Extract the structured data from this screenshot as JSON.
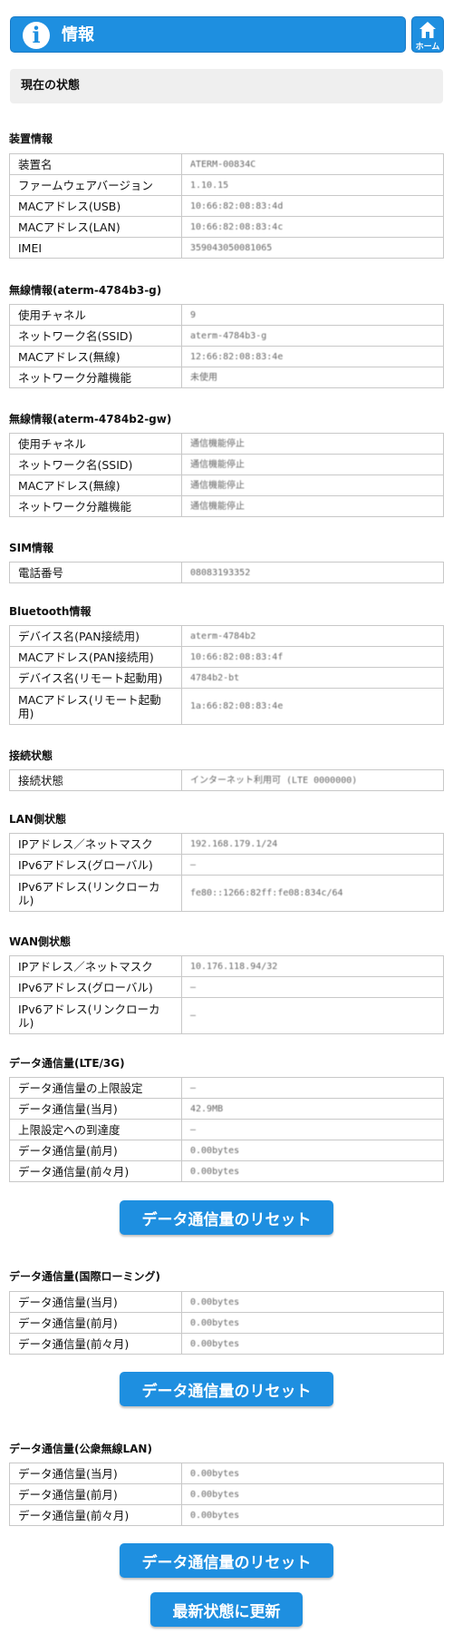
{
  "header": {
    "title": "情報",
    "home_label": "ホーム"
  },
  "status_heading": "現在の状態",
  "sections": {
    "device": {
      "title": "装置情報",
      "rows": [
        {
          "label": "装置名",
          "value": "ATERM-00834C"
        },
        {
          "label": "ファームウェアバージョン",
          "value": "1.10.15"
        },
        {
          "label": "MACアドレス(USB)",
          "value": "10:66:82:08:83:4d"
        },
        {
          "label": "MACアドレス(LAN)",
          "value": "10:66:82:08:83:4c"
        },
        {
          "label": "IMEI",
          "value": "359043050081065"
        }
      ]
    },
    "wireless1": {
      "title": "無線情報(aterm-4784b3-g)",
      "rows": [
        {
          "label": "使用チャネル",
          "value": "9"
        },
        {
          "label": "ネットワーク名(SSID)",
          "value": "aterm-4784b3-g"
        },
        {
          "label": "MACアドレス(無線)",
          "value": "12:66:82:08:83:4e"
        },
        {
          "label": "ネットワーク分離機能",
          "value": "未使用"
        }
      ]
    },
    "wireless2": {
      "title": "無線情報(aterm-4784b2-gw)",
      "rows": [
        {
          "label": "使用チャネル",
          "value": "通信機能停止"
        },
        {
          "label": "ネットワーク名(SSID)",
          "value": "通信機能停止"
        },
        {
          "label": "MACアドレス(無線)",
          "value": "通信機能停止"
        },
        {
          "label": "ネットワーク分離機能",
          "value": "通信機能停止"
        }
      ]
    },
    "sim": {
      "title": "SIM情報",
      "rows": [
        {
          "label": "電話番号",
          "value": "08083193352"
        }
      ]
    },
    "bluetooth": {
      "title": "Bluetooth情報",
      "rows": [
        {
          "label": "デバイス名(PAN接続用)",
          "value": "aterm-4784b2"
        },
        {
          "label": "MACアドレス(PAN接続用)",
          "value": "10:66:82:08:83:4f"
        },
        {
          "label": "デバイス名(リモート起動用)",
          "value": "4784b2-bt"
        },
        {
          "label": "MACアドレス(リモート起動用)",
          "value": "1a:66:82:08:83:4e"
        }
      ]
    },
    "connection": {
      "title": "接続状態",
      "rows": [
        {
          "label": "接続状態",
          "value": "インターネット利用可 (LTE 0000000)"
        }
      ]
    },
    "lan": {
      "title": "LAN側状態",
      "rows": [
        {
          "label": "IPアドレス／ネットマスク",
          "value": "192.168.179.1/24"
        },
        {
          "label": "IPv6アドレス(グローバル)",
          "value": "—"
        },
        {
          "label": "IPv6アドレス(リンクローカル)",
          "value": "fe80::1266:82ff:fe08:834c/64"
        }
      ]
    },
    "wan": {
      "title": "WAN側状態",
      "rows": [
        {
          "label": "IPアドレス／ネットマスク",
          "value": "10.176.118.94/32"
        },
        {
          "label": "IPv6アドレス(グローバル)",
          "value": "—"
        },
        {
          "label": "IPv6アドレス(リンクローカル)",
          "value": "—"
        }
      ]
    },
    "data_lte": {
      "title": "データ通信量(LTE/3G)",
      "rows": [
        {
          "label": "データ通信量の上限設定",
          "value": "—"
        },
        {
          "label": "データ通信量(当月)",
          "value": "42.9MB"
        },
        {
          "label": "上限設定への到達度",
          "value": "—"
        },
        {
          "label": "データ通信量(前月)",
          "value": "0.00bytes"
        },
        {
          "label": "データ通信量(前々月)",
          "value": "0.00bytes"
        }
      ]
    },
    "data_roaming": {
      "title": "データ通信量(国際ローミング)",
      "rows": [
        {
          "label": "データ通信量(当月)",
          "value": "0.00bytes"
        },
        {
          "label": "データ通信量(前月)",
          "value": "0.00bytes"
        },
        {
          "label": "データ通信量(前々月)",
          "value": "0.00bytes"
        }
      ]
    },
    "data_public": {
      "title": "データ通信量(公衆無線LAN)",
      "rows": [
        {
          "label": "データ通信量(当月)",
          "value": "0.00bytes"
        },
        {
          "label": "データ通信量(前月)",
          "value": "0.00bytes"
        },
        {
          "label": "データ通信量(前々月)",
          "value": "0.00bytes"
        }
      ]
    }
  },
  "buttons": {
    "reset_label": "データ通信量のリセット",
    "refresh_label": "最新状態に更新"
  }
}
